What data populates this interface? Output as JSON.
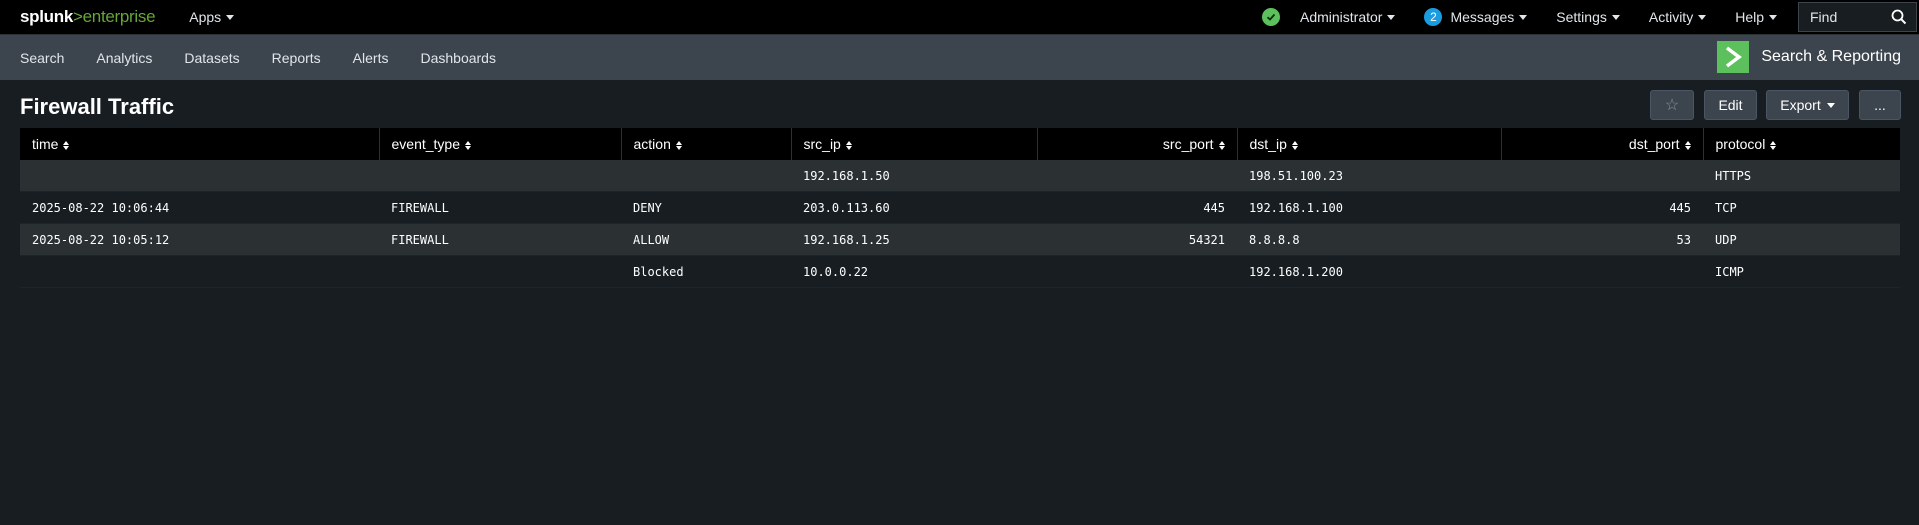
{
  "topbar": {
    "logo_main": "splunk",
    "logo_sep": ">",
    "logo_product": "enterprise",
    "apps_label": "Apps",
    "nav": [
      {
        "label": "Administrator"
      },
      {
        "label": "Messages",
        "badge": "2"
      },
      {
        "label": "Settings"
      },
      {
        "label": "Activity"
      },
      {
        "label": "Help"
      }
    ],
    "find_placeholder": "Find",
    "status_color": "#5cc05c"
  },
  "appbar": {
    "items": [
      "Search",
      "Analytics",
      "Datasets",
      "Reports",
      "Alerts",
      "Dashboards"
    ],
    "app_name": "Search & Reporting",
    "app_icon": "chevron-right-icon",
    "accent": "#5cc05c"
  },
  "dashboard": {
    "title": "Firewall Traffic",
    "star_icon": "☆",
    "edit_label": "Edit",
    "export_label": "Export",
    "more_label": "..."
  },
  "table": {
    "columns": [
      "time",
      "event_type",
      "action",
      "src_ip",
      "src_port",
      "dst_ip",
      "dst_port",
      "protocol"
    ],
    "rows": [
      [
        "",
        "",
        "",
        "192.168.1.50",
        "",
        "198.51.100.23",
        "",
        "HTTPS"
      ],
      [
        "2025-08-22 10:06:44",
        "FIREWALL",
        "DENY",
        "203.0.113.60",
        "445",
        "192.168.1.100",
        "445",
        "TCP"
      ],
      [
        "2025-08-22 10:05:12",
        "FIREWALL",
        "ALLOW",
        "192.168.1.25",
        "54321",
        "8.8.8.8",
        "53",
        "UDP"
      ],
      [
        "",
        "",
        "Blocked",
        "10.0.0.22",
        "",
        "192.168.1.200",
        "",
        "ICMP"
      ]
    ]
  }
}
